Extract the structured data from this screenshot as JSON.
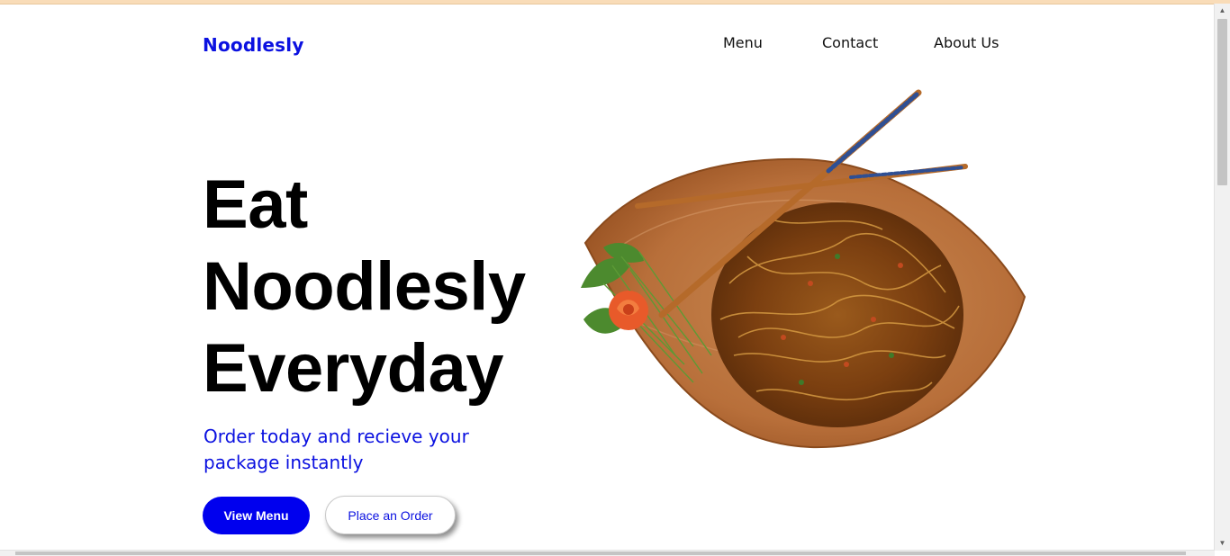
{
  "brand": {
    "name": "Noodlesly"
  },
  "nav": {
    "items": [
      "Menu",
      "Contact",
      "About Us"
    ]
  },
  "hero": {
    "headline": [
      "Eat",
      "Noodlesly",
      "Everyday"
    ],
    "subtitle": "Order today and recieve your package instantly",
    "primary_button": "View Menu",
    "secondary_button": "Place an Order",
    "image_icon": "noodle-plate-icon"
  },
  "colors": {
    "brand_blue": "#0b11e0",
    "button_blue": "#0000ee",
    "text": "#000000"
  }
}
